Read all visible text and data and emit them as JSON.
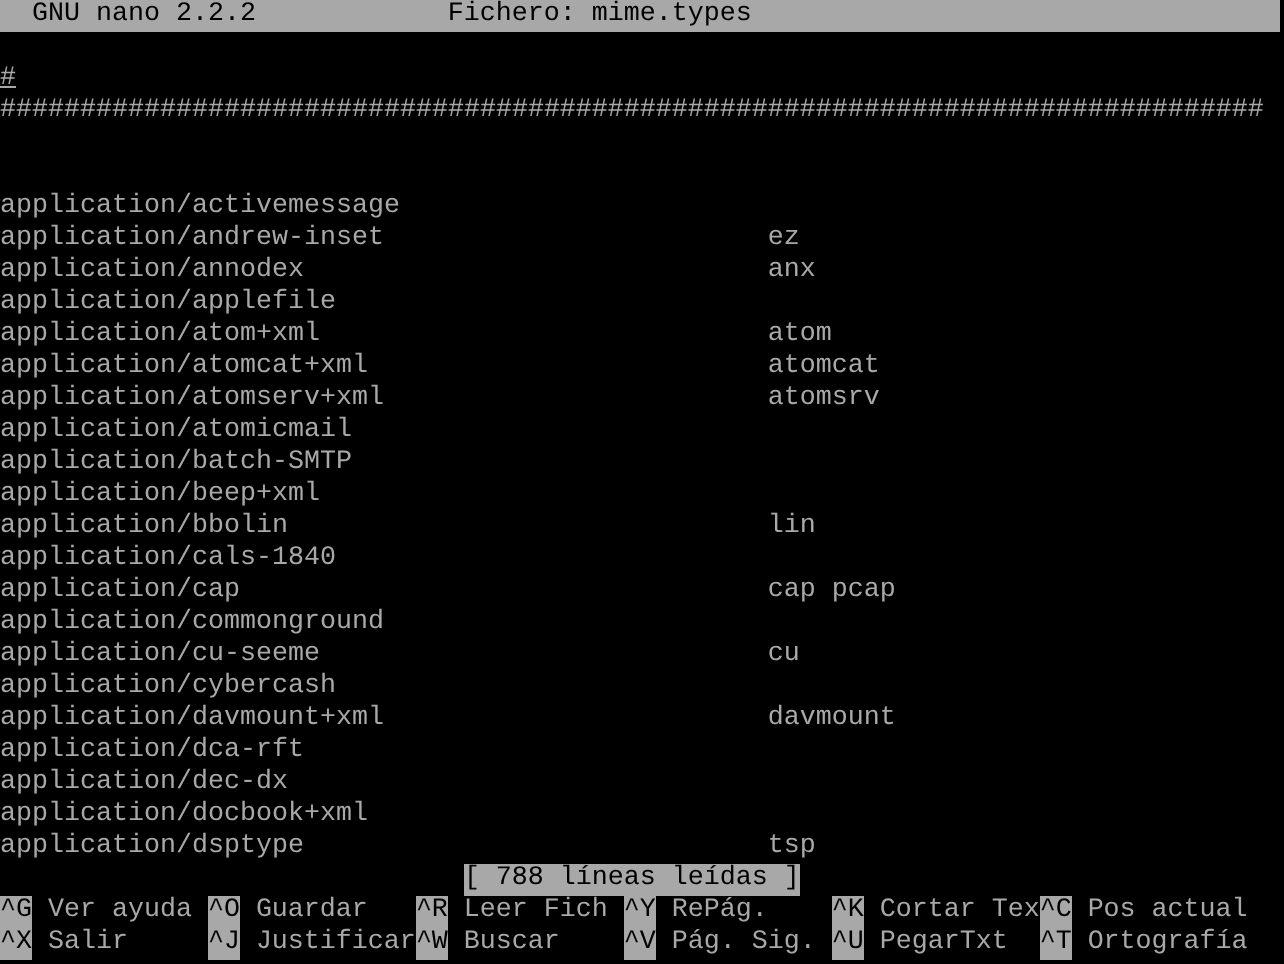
{
  "title_bar": {
    "app": "GNU nano 2.2.2",
    "file": "Fichero: mime.types"
  },
  "header_lines": [
    "#",
    "###############################################################################"
  ],
  "entries": [
    {
      "mime": "application/activemessage"
    },
    {
      "mime": "application/andrew-inset",
      "ext": "ez"
    },
    {
      "mime": "application/annodex",
      "ext": "anx"
    },
    {
      "mime": "application/applefile"
    },
    {
      "mime": "application/atom+xml",
      "ext": "atom"
    },
    {
      "mime": "application/atomcat+xml",
      "ext": "atomcat"
    },
    {
      "mime": "application/atomserv+xml",
      "ext": "atomsrv"
    },
    {
      "mime": "application/atomicmail"
    },
    {
      "mime": "application/batch-SMTP"
    },
    {
      "mime": "application/beep+xml"
    },
    {
      "mime": "application/bbolin",
      "ext": "lin"
    },
    {
      "mime": "application/cals-1840"
    },
    {
      "mime": "application/cap",
      "ext": "cap pcap"
    },
    {
      "mime": "application/commonground"
    },
    {
      "mime": "application/cu-seeme",
      "ext": "cu"
    },
    {
      "mime": "application/cybercash"
    },
    {
      "mime": "application/davmount+xml",
      "ext": "davmount"
    },
    {
      "mime": "application/dca-rft"
    },
    {
      "mime": "application/dec-dx"
    },
    {
      "mime": "application/docbook+xml"
    },
    {
      "mime": "application/dsptype",
      "ext": "tsp"
    }
  ],
  "status": "[ 788 líneas leídas ]",
  "shortcuts": [
    [
      {
        "key": "^G",
        "label": "Ver ayuda"
      },
      {
        "key": "^O",
        "label": "Guardar"
      },
      {
        "key": "^R",
        "label": "Leer Fich"
      },
      {
        "key": "^Y",
        "label": "RePág."
      },
      {
        "key": "^K",
        "label": "Cortar Tex"
      },
      {
        "key": "^C",
        "label": "Pos actual"
      }
    ],
    [
      {
        "key": "^X",
        "label": "Salir"
      },
      {
        "key": "^J",
        "label": "Justificar"
      },
      {
        "key": "^W",
        "label": "Buscar"
      },
      {
        "key": "^V",
        "label": "Pág. Sig."
      },
      {
        "key": "^U",
        "label": "PegarTxt"
      },
      {
        "key": "^T",
        "label": "Ortografía"
      }
    ]
  ]
}
